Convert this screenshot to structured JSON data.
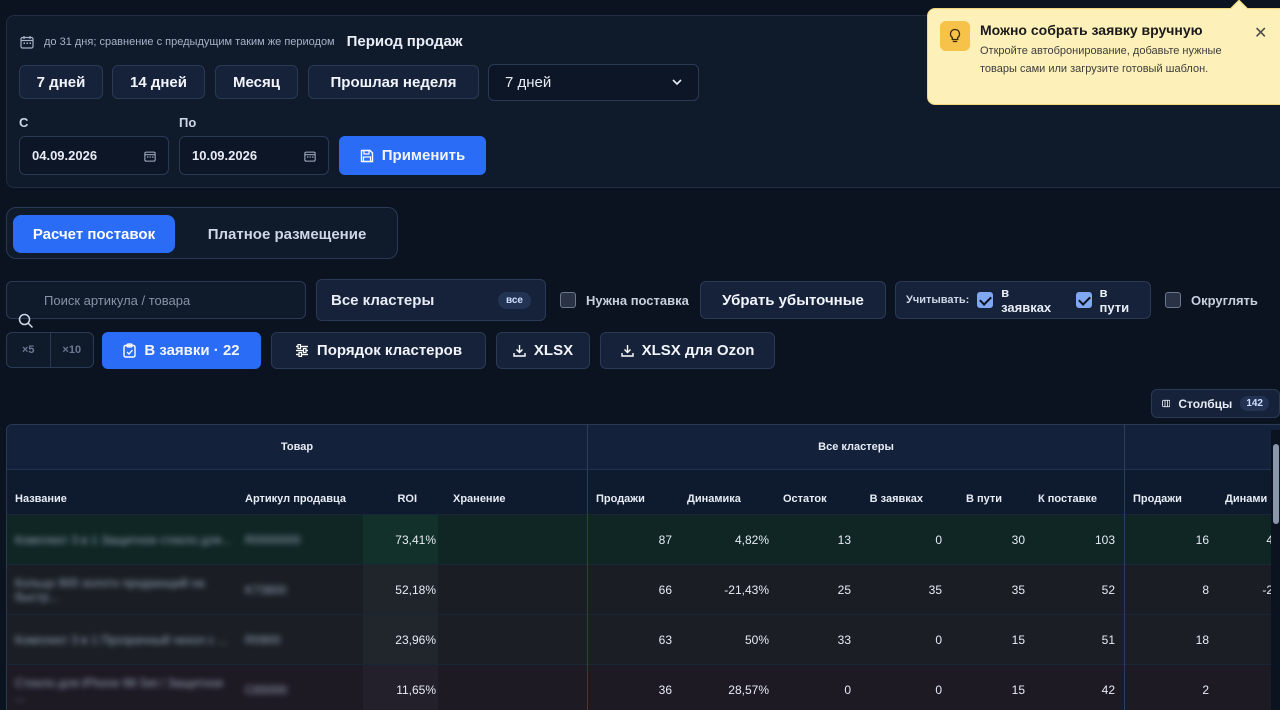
{
  "period": {
    "note": "до 31 дня; сравнение с предыдущим таким же периодом",
    "title": "Период продаж",
    "presets": [
      "7 дней",
      "14 дней",
      "Месяц",
      "Прошлая неделя"
    ],
    "select_value": "7 дней",
    "from_label": "С",
    "to_label": "По",
    "from_value": "04.09.2026",
    "to_value": "10.09.2026",
    "apply_label": "Применить"
  },
  "tabs": {
    "active": "Расчет поставок",
    "other": "Платное размещение"
  },
  "filters": {
    "search_placeholder": "Поиск артикула / товара",
    "clusters_label": "Все кластеры",
    "clusters_badge": "все",
    "need_supply": "Нужна поставка",
    "remove_loss": "Убрать убыточные",
    "consider_label": "Учитывать:",
    "in_orders": "в заявках",
    "in_transit": "в пути",
    "round": "Округлять"
  },
  "actions": {
    "x5": "×5",
    "x10": "×10",
    "to_orders": "В заявки · 22",
    "cluster_order": "Порядок кластеров",
    "xlsx": "XLSX",
    "xlsx_ozon": "XLSX для Ozon",
    "columns": "Столбцы",
    "columns_count": "142"
  },
  "toast": {
    "title": "Можно собрать заявку вручную",
    "text": "Откройте автобронирование, добавьте нужные товары сами или загрузите готовый шаблон."
  },
  "table": {
    "group_product": "Товар",
    "group_all": "Все кластеры",
    "h_name": "Название",
    "h_article": "Артикул продавца",
    "h_roi": "ROI",
    "h_storage": "Хранение",
    "h_sales": "Продажи",
    "h_dyn": "Динамика",
    "h_stock": "Остаток",
    "h_orders": "В заявках",
    "h_transit": "В пути",
    "h_supply": "К поставке",
    "h_sales2": "Продажи",
    "h_dyn2": "Динами",
    "rows": [
      {
        "name": "Комплект 3 в 1 Защитное стекло для...",
        "article": "R0000000",
        "roi": "73,41%",
        "sales": "87",
        "dyn": "4,82%",
        "stock": "13",
        "orders": "0",
        "transit": "30",
        "supply": "103",
        "sales2": "16",
        "dyn2": "4"
      },
      {
        "name": "Кольцо 900 золото продающий на быстр...",
        "article": "K73800",
        "roi": "52,18%",
        "sales": "66",
        "dyn": "-21,43%",
        "stock": "25",
        "orders": "35",
        "transit": "35",
        "supply": "52",
        "sales2": "8",
        "dyn2": "-2"
      },
      {
        "name": "Комплект 3 в 1 Прозрачный чехол с ...",
        "article": "R0900",
        "roi": "23,96%",
        "sales": "63",
        "dyn": "50%",
        "stock": "33",
        "orders": "0",
        "transit": "15",
        "supply": "51",
        "sales2": "18",
        "dyn2": ""
      },
      {
        "name": "Стекло для iPhone 98 Set / Защитное ...",
        "article": "C65000",
        "roi": "11,65%",
        "sales": "36",
        "dyn": "28,57%",
        "stock": "0",
        "orders": "0",
        "transit": "15",
        "supply": "42",
        "sales2": "2",
        "dyn2": ""
      }
    ]
  }
}
